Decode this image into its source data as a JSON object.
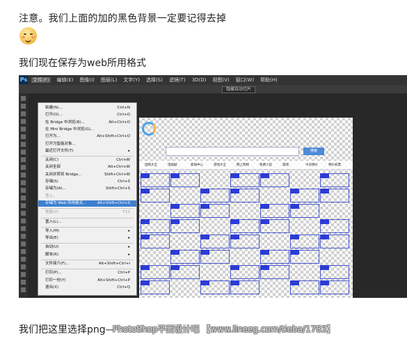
{
  "blog": {
    "note_text": "注意。我们上面的加的黑色背景一定要记得去掉",
    "save_web_text": "我们现在保存为web所用格式",
    "bottom_text": "我们把这里选择png—",
    "watermark_text": "PhotoShop平面设计吧 【www.lineeg.com/tieba/1783】"
  },
  "photoshop": {
    "logo": "Ps",
    "menus": [
      "文件(F)",
      "编辑(E)",
      "图像(I)",
      "图层(L)",
      "文字(Y)",
      "选择(S)",
      "滤镜(T)",
      "3D(D)",
      "视图(V)",
      "窗口(W)",
      "帮助(H)"
    ],
    "active_menu": "文件(F)",
    "option_button": "隐藏自动切片",
    "file_menu": [
      {
        "label": "新建(N)...",
        "shortcut": "Ctrl+N"
      },
      {
        "label": "打开(O)...",
        "shortcut": "Ctrl+O"
      },
      {
        "label": "在 Bridge 中浏览(B)...",
        "shortcut": "Alt+Ctrl+O"
      },
      {
        "label": "在 Mini Bridge 中浏览(G)...",
        "shortcut": ""
      },
      {
        "label": "打开为...",
        "shortcut": "Alt+Shift+Ctrl+O"
      },
      {
        "label": "打开为智能对象...",
        "shortcut": ""
      },
      {
        "label": "最近打开文件(T)",
        "shortcut": "▸"
      },
      {
        "label": "关闭(C)",
        "shortcut": "Ctrl+W"
      },
      {
        "label": "关闭全部",
        "shortcut": "Alt+Ctrl+W"
      },
      {
        "label": "关闭并转到 Bridge...",
        "shortcut": "Shift+Ctrl+W"
      },
      {
        "label": "存储(S)",
        "shortcut": "Ctrl+S"
      },
      {
        "label": "存储为(A)...",
        "shortcut": "Shift+Ctrl+S"
      },
      {
        "label": "签入...",
        "shortcut": ""
      },
      {
        "label": "存储为 Web 所用格式...",
        "shortcut": "Alt+Shift+Ctrl+S"
      },
      {
        "label": "恢复(V)",
        "shortcut": "F12"
      },
      {
        "label": "置入(L)...",
        "shortcut": ""
      },
      {
        "label": "导入(M)",
        "shortcut": "▸"
      },
      {
        "label": "导出(E)",
        "shortcut": "▸"
      },
      {
        "label": "自动(U)",
        "shortcut": "▸"
      },
      {
        "label": "脚本(R)",
        "shortcut": "▸"
      },
      {
        "label": "文件简介(F)...",
        "shortcut": "Alt+Shift+Ctrl+I"
      },
      {
        "label": "打印(P)...",
        "shortcut": "Ctrl+P"
      },
      {
        "label": "打印一份(Y)",
        "shortcut": "Alt+Shift+Ctrl+P"
      },
      {
        "label": "退出(X)",
        "shortcut": "Ctrl+Q"
      }
    ],
    "highlighted_item": "存储为 Web 所用格式...",
    "canvas": {
      "search_button": "搜索",
      "nav_items": [
        "团购大全",
        "电视剧",
        "新闻中心",
        "游戏大全",
        "网上购物",
        "免费小说",
        "游戏",
        "今日特价",
        "特价机票"
      ]
    }
  }
}
